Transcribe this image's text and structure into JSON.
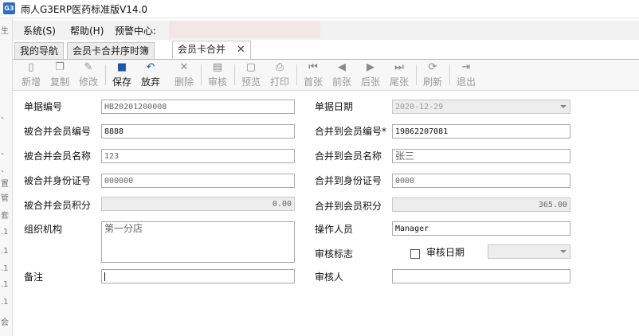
{
  "window": {
    "icon_label": "G3",
    "title": "雨人G3ERP医药标准版V14.0"
  },
  "menu": {
    "items": [
      "系统(S)",
      "帮助(H)",
      "预警中心:"
    ]
  },
  "tabs": [
    {
      "label": "我的导航",
      "active": false
    },
    {
      "label": "会员卡合并序时簿",
      "active": false
    },
    {
      "label": "会员卡合并",
      "active": true
    }
  ],
  "toolbar": {
    "items": [
      {
        "label": "新增",
        "icon": "new-doc-icon",
        "enabled": false
      },
      {
        "label": "复制",
        "icon": "copy-icon",
        "enabled": false
      },
      {
        "label": "修改",
        "icon": "edit-icon",
        "enabled": false
      },
      {
        "label": "保存",
        "icon": "save-icon",
        "enabled": true
      },
      {
        "label": "放弃",
        "icon": "undo-icon",
        "enabled": true
      },
      {
        "label": "删除",
        "icon": "delete-icon",
        "enabled": false
      },
      {
        "label": "审核",
        "icon": "audit-icon",
        "enabled": false
      },
      {
        "label": "预览",
        "icon": "preview-icon",
        "enabled": false
      },
      {
        "label": "打印",
        "icon": "print-icon",
        "enabled": false
      },
      {
        "label": "首张",
        "icon": "first-icon",
        "enabled": false
      },
      {
        "label": "前张",
        "icon": "prev-icon",
        "enabled": false
      },
      {
        "label": "后张",
        "icon": "next-icon",
        "enabled": false
      },
      {
        "label": "尾张",
        "icon": "last-icon",
        "enabled": false
      },
      {
        "label": "刷新",
        "icon": "refresh-icon",
        "enabled": false
      },
      {
        "label": "退出",
        "icon": "exit-icon",
        "enabled": false
      }
    ]
  },
  "form": {
    "doc_no": {
      "label": "单据编号",
      "value": "HB20201200008"
    },
    "doc_date": {
      "label": "单据日期",
      "value": "2020-12-29"
    },
    "from_member_no": {
      "label": "被合并会员编号",
      "value": "8888"
    },
    "to_member_no": {
      "label": "合并到会员编号*",
      "value": "19862207081"
    },
    "from_member_name": {
      "label": "被合并会员名称",
      "value": "123"
    },
    "to_member_name": {
      "label": "合并到会员名称",
      "value": "张三"
    },
    "from_id_no": {
      "label": "被合并身份证号",
      "value": "000000"
    },
    "to_id_no": {
      "label": "合并到身份证号",
      "value": "0000"
    },
    "from_points": {
      "label": "被合并会员积分",
      "value": "0.00"
    },
    "to_points": {
      "label": "合并到会员积分",
      "value": "365.00"
    },
    "org": {
      "label": "组织机构",
      "value": "第一分店"
    },
    "operator": {
      "label": "操作人员",
      "value": "Manager"
    },
    "audit_flag": {
      "label": "审核标志"
    },
    "audit_date": {
      "label": "审核日期",
      "value": ""
    },
    "remark": {
      "label": "备注",
      "value": ""
    },
    "auditor": {
      "label": "审核人",
      "value": ""
    }
  }
}
